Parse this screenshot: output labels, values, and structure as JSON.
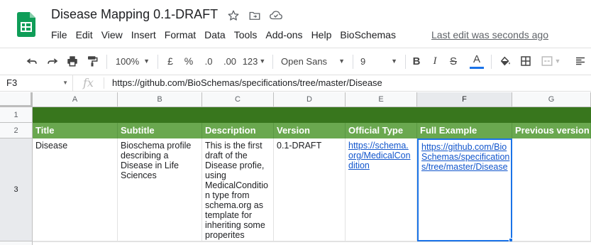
{
  "app": {
    "title": "Disease Mapping 0.1-DRAFT",
    "logo_icon": "google-sheets-logo",
    "title_icons": [
      "star-icon",
      "move-to-folder-icon",
      "cloud-saved-icon"
    ],
    "last_edit": "Last edit was seconds ago"
  },
  "menu": {
    "items": [
      "File",
      "Edit",
      "View",
      "Insert",
      "Format",
      "Data",
      "Tools",
      "Add-ons",
      "Help",
      "BioSchemas"
    ]
  },
  "toolbar": {
    "zoom": "100%",
    "currency": "£",
    "percent": "%",
    "decrease_decimal": ".0",
    "increase_decimal": ".00",
    "more_formats": "123",
    "font": "Open Sans",
    "font_size": "9",
    "bold": "B",
    "italic": "I",
    "strikethrough": "S",
    "text_color": "A"
  },
  "formula_bar": {
    "cell_ref": "F3",
    "fx_label": "fx",
    "value": "https://github.com/BioSchemas/specifications/tree/master/Disease"
  },
  "grid": {
    "columns": [
      "A",
      "B",
      "C",
      "D",
      "E",
      "F",
      "G"
    ],
    "rows": [
      "1",
      "2",
      "3"
    ],
    "header_row": [
      "Title",
      "Subtitle",
      "Description",
      "Version",
      "Official Type",
      "Full Example",
      "Previous version"
    ],
    "data_row": {
      "title": "Disease",
      "subtitle_lines": [
        "Bioschema profile",
        "describing a",
        "Disease in Life",
        "Sciences"
      ],
      "description_lines": [
        "This is the first",
        "draft of the",
        "Disease profie,",
        "using",
        "MedicalConditio",
        "n type from",
        "schema.org as",
        "template for",
        "inheriting some",
        "properites"
      ],
      "version": "0.1-DRAFT",
      "official_type_lines": [
        "https://schema.",
        "org/MedicalCon",
        "dition"
      ],
      "full_example_lines": [
        "https://github.com/Bio",
        "Schemas/specification",
        "s/tree/master/Disease"
      ],
      "previous_version": ""
    }
  },
  "colors": {
    "dark_green": "#38761d",
    "header_green": "#6aa84f",
    "link_blue": "#1155cc",
    "selection_blue": "#1a73e8"
  }
}
